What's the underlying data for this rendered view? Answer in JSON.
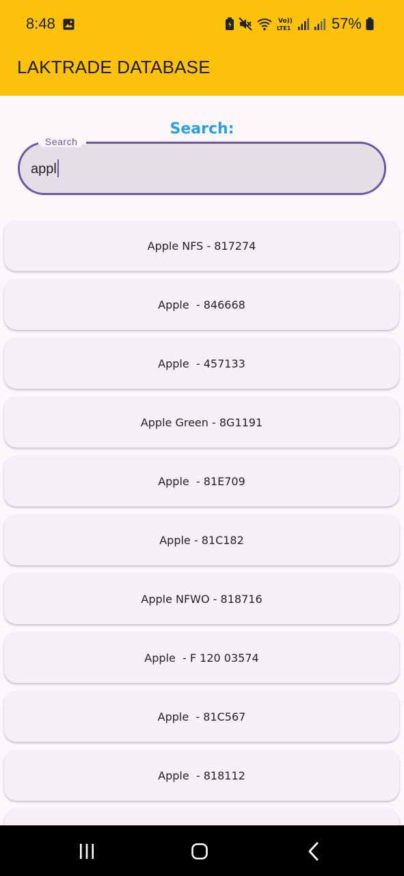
{
  "status_bar": {
    "time": "8:48",
    "battery_percent": "57%",
    "icons": [
      "gallery-icon",
      "battery-saver-icon",
      "mute-icon",
      "wifi-icon",
      "volte-lte-icon",
      "signal-icon",
      "signal-icon",
      "battery-icon"
    ],
    "volte_text": "Vo)) LTE1"
  },
  "app_bar": {
    "title": "LAKTRADE DATABASE",
    "color": "#fcc10b"
  },
  "search": {
    "heading": "Search:",
    "label": "Search",
    "value": "appl",
    "heading_color": "#2a9de6",
    "border_color": "#6b55a4"
  },
  "results": [
    "Apple NFS - 817274",
    "Apple  - 846668",
    "Apple  - 457133",
    "Apple Green - 8G1191",
    "Apple  - 81E709",
    "Apple - 81C182",
    "Apple NFWO - 818716",
    "Apple  - F 120 03574",
    "Apple  - 81C567",
    "Apple  - 818112"
  ],
  "nav_bar": {
    "buttons": [
      "recents-icon",
      "home-icon",
      "back-icon"
    ]
  }
}
